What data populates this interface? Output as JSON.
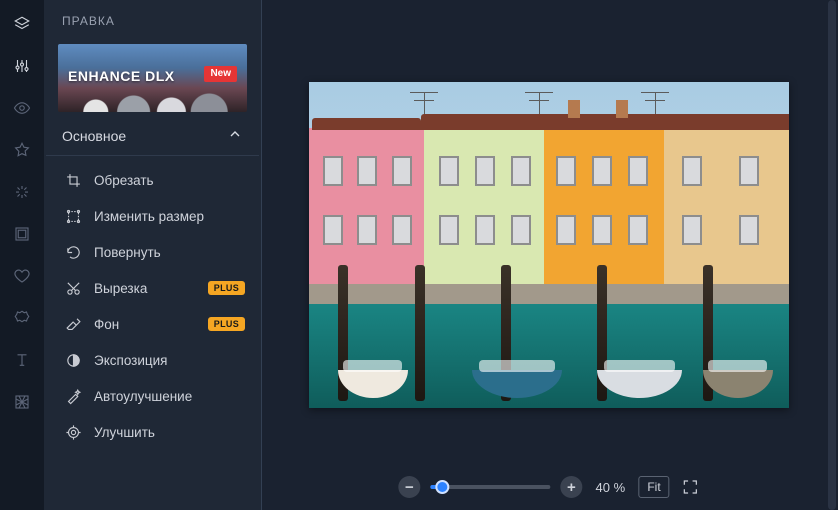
{
  "panel": {
    "title": "ПРАВКА",
    "banner": {
      "text": "ENHANCE DLX",
      "badge": "New"
    },
    "section": {
      "title": "Основное"
    }
  },
  "rail": [
    {
      "name": "layers-icon"
    },
    {
      "name": "sliders-icon"
    },
    {
      "name": "eye-icon"
    },
    {
      "name": "star-icon"
    },
    {
      "name": "sparkle-icon"
    },
    {
      "name": "frame-icon"
    },
    {
      "name": "heart-icon"
    },
    {
      "name": "badge-icon"
    },
    {
      "name": "text-icon"
    },
    {
      "name": "texture-icon"
    }
  ],
  "tools": [
    {
      "icon": "crop-icon",
      "label": "Обрезать",
      "plus": false
    },
    {
      "icon": "resize-icon",
      "label": "Изменить размер",
      "plus": false
    },
    {
      "icon": "rotate-icon",
      "label": "Повернуть",
      "plus": false
    },
    {
      "icon": "cutout-icon",
      "label": "Вырезка",
      "plus": true
    },
    {
      "icon": "eraser-icon",
      "label": "Фон",
      "plus": true
    },
    {
      "icon": "exposure-icon",
      "label": "Экспозиция",
      "plus": false
    },
    {
      "icon": "autoenhance-icon",
      "label": "Автоулучшение",
      "plus": false
    },
    {
      "icon": "enhance-icon",
      "label": "Улучшить",
      "plus": false
    }
  ],
  "plus_label": "PLUS",
  "zoom": {
    "value": "40 %",
    "fit": "Fit",
    "percent": 10
  }
}
